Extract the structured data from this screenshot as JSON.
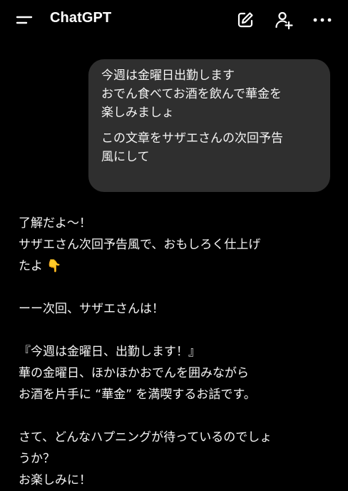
{
  "header": {
    "title": "ChatGPT",
    "icons": [
      "menu-icon",
      "compose-icon",
      "add-user-icon",
      "more-icon"
    ]
  },
  "user_message": {
    "paragraphs": [
      "今週は金曜日出勤します\nおでん食べてお酒を飲んで華金を\n楽しみましょ",
      "この文章をサザエさんの次回予告\n風にして"
    ]
  },
  "assistant_message": {
    "paragraphs": [
      "了解だよ〜！\nサザエさん次回予告風で、おもしろく仕上げ\nたよ 👇",
      "ーー次回、サザエさんは！",
      "『今週は金曜日、出勤します！』\n華の金曜日、ほかほかおでんを囲みながら\nお酒を片手に “華金” を満喫するお話です。",
      "さて、どんなハプニングが待っているのでしょ\nうか？\nお楽しみに！"
    ]
  },
  "colors": {
    "background": "#000000",
    "bubble": "#2f2f2f",
    "text": "#f5f5f5"
  }
}
